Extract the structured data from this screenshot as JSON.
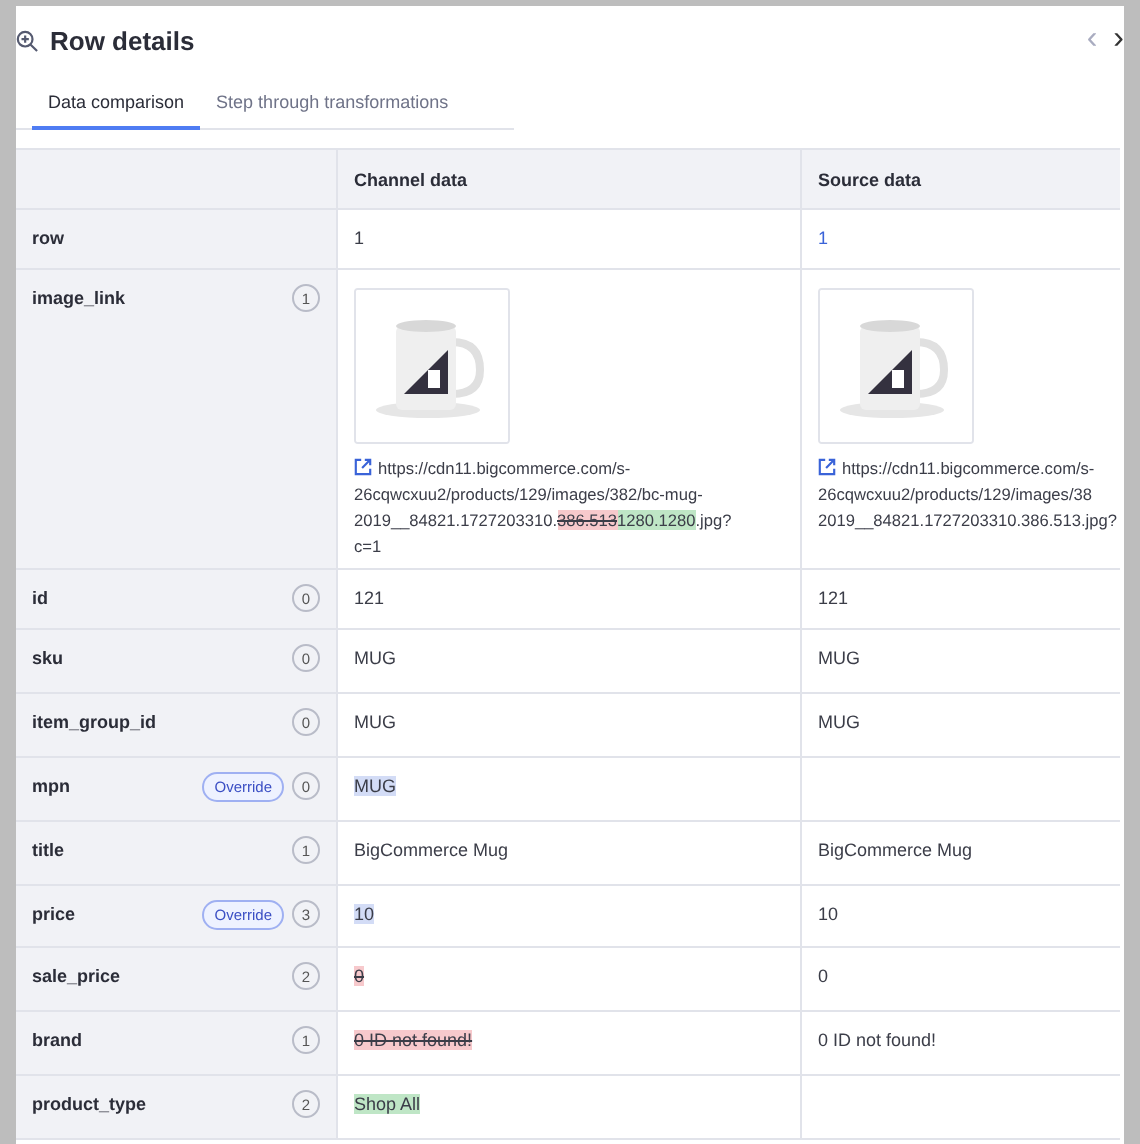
{
  "title": "Row details",
  "nav": {
    "prev": "‹",
    "next": "›"
  },
  "tabs": [
    {
      "label": "Data comparison",
      "selected": true
    },
    {
      "label": "Step through transformations",
      "selected": false
    }
  ],
  "columns": [
    "Channel data",
    "Source data"
  ],
  "rows": [
    {
      "field": "row",
      "channel": {
        "kind": "text",
        "segments": [
          {
            "text": "1",
            "kind": "plain"
          }
        ]
      },
      "source": {
        "kind": "text",
        "segments": [
          {
            "text": "1",
            "kind": "link"
          }
        ]
      }
    },
    {
      "field": "image_link",
      "count": "1",
      "channel": {
        "lines": [
          [
            {
              "text": "https://cdn11.bigcommerce.com/s-",
              "kind": "plain"
            }
          ],
          [
            {
              "text": "26cqwcxuu2/products/129/images/382/bc-mug-",
              "kind": "plain"
            }
          ],
          [
            {
              "text": "2019__84821.1727203310.",
              "kind": "plain"
            },
            {
              "text": "386.513",
              "kind": "removed"
            },
            {
              "text": "1280.1280",
              "kind": "added"
            },
            {
              "text": ".jpg?",
              "kind": "plain"
            }
          ],
          [
            {
              "text": "c=1",
              "kind": "plain"
            }
          ]
        ]
      },
      "source": {
        "lines": [
          [
            {
              "text": "https://cdn11.bigcommerce.com/s-",
              "kind": "plain"
            }
          ],
          [
            {
              "text": "26cqwcxuu2/products/129/images/38",
              "kind": "plain"
            }
          ],
          [
            {
              "text": "2019__84821.1727203310.386.513.jpg?",
              "kind": "plain"
            }
          ]
        ]
      }
    },
    {
      "field": "id",
      "count": "0",
      "channel": {
        "kind": "text",
        "segments": [
          {
            "text": "121",
            "kind": "plain"
          }
        ]
      },
      "source": {
        "kind": "text",
        "segments": [
          {
            "text": "121",
            "kind": "plain"
          }
        ]
      }
    },
    {
      "field": "sku",
      "count": "0",
      "channel": {
        "kind": "text",
        "segments": [
          {
            "text": "MUG",
            "kind": "plain"
          }
        ]
      },
      "source": {
        "kind": "text",
        "segments": [
          {
            "text": "MUG",
            "kind": "plain"
          }
        ]
      }
    },
    {
      "field": "item_group_id",
      "count": "0",
      "channel": {
        "kind": "text",
        "segments": [
          {
            "text": "MUG",
            "kind": "plain"
          }
        ]
      },
      "source": {
        "kind": "text",
        "segments": [
          {
            "text": "MUG",
            "kind": "plain"
          }
        ]
      }
    },
    {
      "field": "mpn",
      "override": "Override",
      "count": "0",
      "channel": {
        "kind": "text",
        "segments": [
          {
            "text": "MUG",
            "kind": "override"
          }
        ]
      }
    },
    {
      "field": "title",
      "count": "1",
      "channel": {
        "kind": "text",
        "segments": [
          {
            "text": "BigCommerce Mug",
            "kind": "plain"
          }
        ]
      },
      "source": {
        "kind": "text",
        "segments": [
          {
            "text": "BigCommerce Mug",
            "kind": "plain"
          }
        ]
      }
    },
    {
      "field": "price",
      "override": "Override",
      "count": "3",
      "channel": {
        "kind": "text",
        "segments": [
          {
            "text": "10",
            "kind": "override"
          }
        ]
      },
      "source": {
        "kind": "text",
        "segments": [
          {
            "text": "10",
            "kind": "plain"
          }
        ]
      }
    },
    {
      "field": "sale_price",
      "count": "2",
      "channel": {
        "kind": "text",
        "segments": [
          {
            "text": "0",
            "kind": "removed"
          }
        ]
      },
      "source": {
        "kind": "text",
        "segments": [
          {
            "text": "0",
            "kind": "plain"
          }
        ]
      }
    },
    {
      "field": "brand",
      "count": "1",
      "channel": {
        "kind": "text",
        "segments": [
          {
            "text": "0 ID not found!",
            "kind": "removed"
          }
        ]
      },
      "source": {
        "kind": "text",
        "segments": [
          {
            "text": "0 ID not found!",
            "kind": "plain"
          }
        ]
      }
    },
    {
      "field": "product_type",
      "count": "2",
      "channel": {
        "kind": "text",
        "segments": [
          {
            "text": "Shop All",
            "kind": "added"
          }
        ]
      }
    }
  ]
}
